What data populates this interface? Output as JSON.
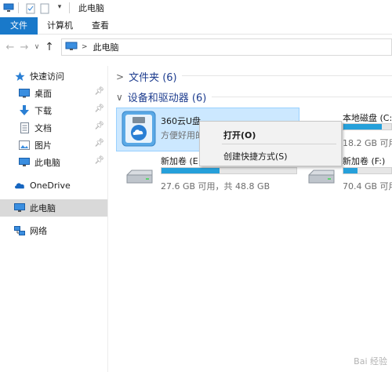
{
  "window": {
    "title": "此电脑"
  },
  "ribbon": {
    "tabs": [
      "文件",
      "计算机",
      "查看"
    ]
  },
  "address": {
    "path": "此电脑"
  },
  "sidebar": {
    "items": [
      {
        "label": "快速访问",
        "icon": "star-icon",
        "pinned": false
      },
      {
        "label": "桌面",
        "icon": "desktop-icon",
        "pinned": true
      },
      {
        "label": "下载",
        "icon": "download-arrow-icon",
        "pinned": true
      },
      {
        "label": "文档",
        "icon": "document-icon",
        "pinned": true
      },
      {
        "label": "图片",
        "icon": "pictures-icon",
        "pinned": true
      },
      {
        "label": "此电脑",
        "icon": "computer-icon",
        "pinned": true
      },
      {
        "label": "OneDrive",
        "icon": "cloud-icon",
        "pinned": false
      },
      {
        "label": "此电脑",
        "icon": "computer-icon",
        "pinned": false,
        "selected": true
      },
      {
        "label": "网络",
        "icon": "network-icon",
        "pinned": false
      }
    ]
  },
  "main": {
    "folders_header": "文件夹 (6)",
    "devices_header": "设备和驱动器 (6)",
    "drives": [
      {
        "name": "360云U盘",
        "info": "方便好用的",
        "kind": "usb-cloud"
      },
      {
        "name": "本地磁盘 (C:",
        "info": "18.2 GB 可用",
        "used_fraction": 0.8,
        "kind": "hdd"
      },
      {
        "name": "新加卷 (E",
        "info": "27.6 GB 可用，共 48.8 GB",
        "used_fraction": 0.43,
        "kind": "hdd"
      },
      {
        "name": "新加卷 (F:)",
        "info": "70.4 GB 可用",
        "used_fraction": 0.3,
        "kind": "hdd"
      }
    ]
  },
  "context_menu": {
    "open": "打开(O)",
    "create_shortcut": "创建快捷方式(S)"
  },
  "watermark": "Bai 经验",
  "colors": {
    "accent": "#1979ca",
    "bar": "#26a0da",
    "selection": "#cce8ff",
    "header_text": "#1e3d8f"
  }
}
